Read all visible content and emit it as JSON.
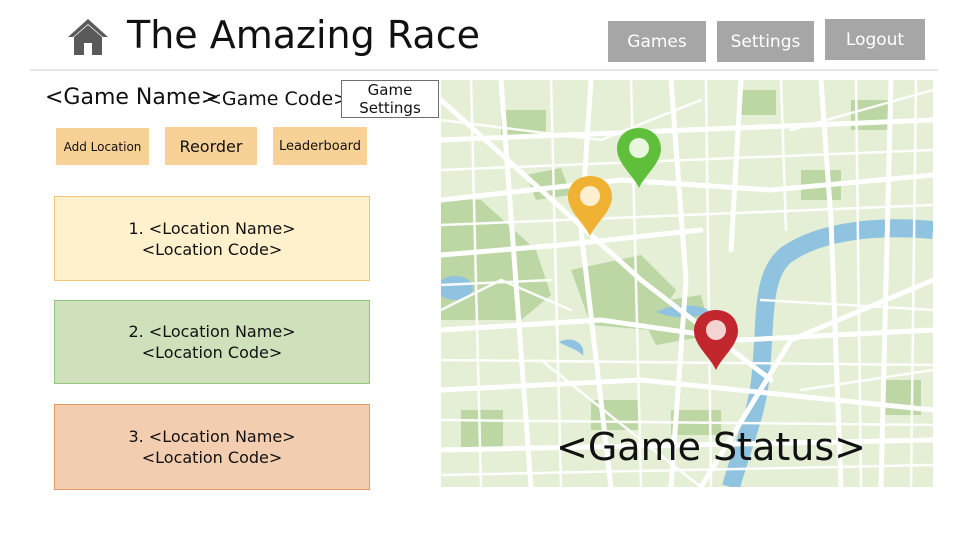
{
  "header": {
    "title": "The Amazing Race",
    "home_icon": "home-icon",
    "nav": {
      "games_label": "Games",
      "settings_label": "Settings",
      "logout_label": "Logout"
    }
  },
  "game": {
    "name": "<Game Name>",
    "code": "<Game Code>",
    "settings_label_line1": "Game",
    "settings_label_line2": "Settings"
  },
  "actions": {
    "add_location_label": "Add Location",
    "reorder_label": "Reorder",
    "leaderboard_label": "Leaderboard"
  },
  "locations": [
    {
      "title": "1. <Location Name>",
      "code": "<Location Code>",
      "color": "#fff1cc"
    },
    {
      "title": "2. <Location Name>",
      "code": "<Location Code>",
      "color": "#cfe1bb"
    },
    {
      "title": "3. <Location Name>",
      "code": "<Location Code>",
      "color": "#f3cdb0"
    }
  ],
  "map": {
    "status": "<Game Status>",
    "pins": [
      {
        "icon": "map-pin-icon",
        "color": "#5fbf3a"
      },
      {
        "icon": "map-pin-icon",
        "color": "#f0b233"
      },
      {
        "icon": "map-pin-icon",
        "color": "#c1272d"
      }
    ],
    "land_color": "#e4efd6",
    "park_color": "#bcd6a4",
    "water_color": "#8fc3e0"
  }
}
